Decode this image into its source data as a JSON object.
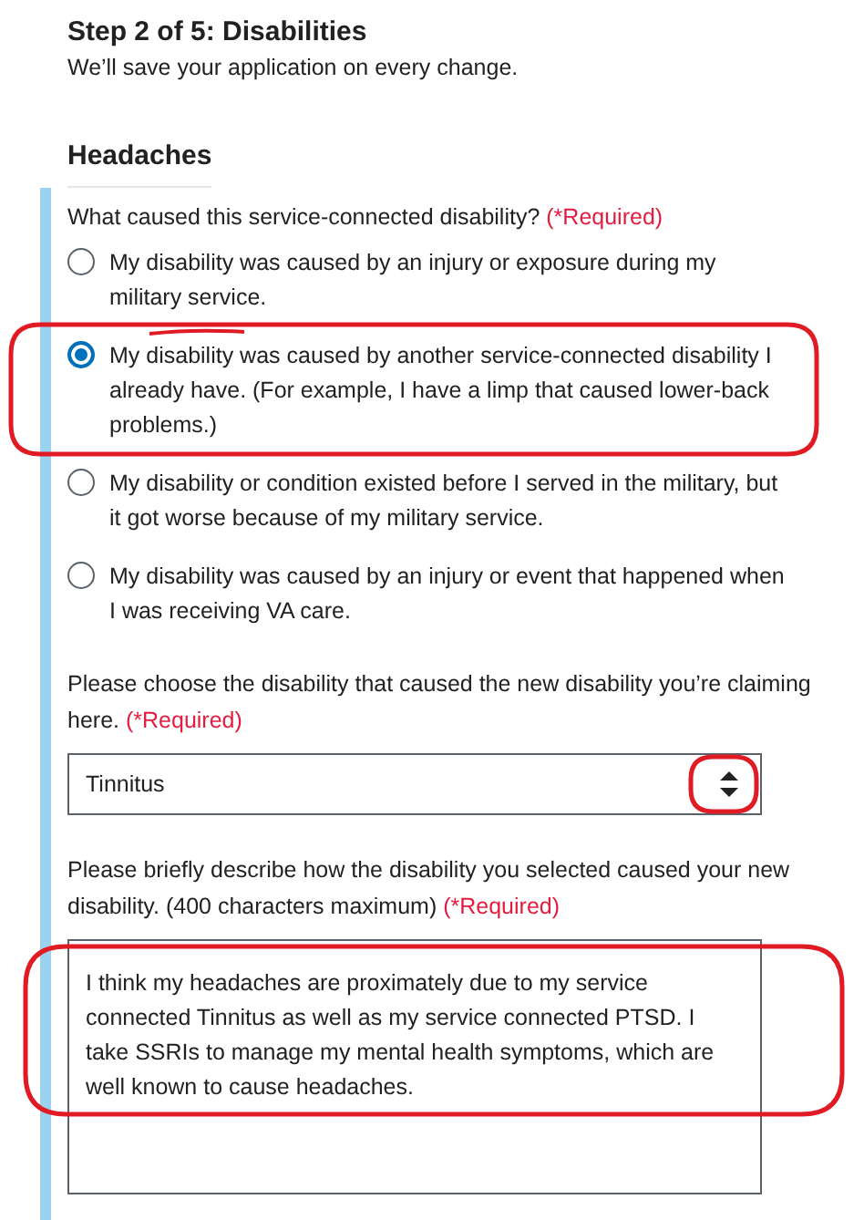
{
  "header": {
    "title": "Step 2 of 5: Disabilities",
    "subtitle": "We’ll save your application on every change."
  },
  "section": {
    "title": "Headaches",
    "question": {
      "label": "What caused this service-connected disability?",
      "required": "(*Required)",
      "options": [
        {
          "label": "My disability was caused by an injury or exposure during my military service.",
          "selected": false
        },
        {
          "label": "My disability was caused by another service-connected disability I already have. (For example, I have a limp that caused lower-back problems.)",
          "selected": true
        },
        {
          "label": "My disability or condition existed before I served in the military, but it got worse because of my military service.",
          "selected": false
        },
        {
          "label": "My disability was caused by an injury or event that happened when I was receiving VA care.",
          "selected": false
        }
      ]
    },
    "select": {
      "label": "Please choose the disability that caused the new disability you’re claiming here.",
      "required": "(*Required)",
      "value": "Tinnitus"
    },
    "description": {
      "label": "Please briefly describe how the disability you selected caused your new disability. (400 characters maximum)",
      "required": "(*Required)",
      "value": "I think my headaches are proximately due to my service connected Tinnitus as well as my service connected PTSD. I take SSRIs to manage my mental health symptoms, which are well known to cause headaches."
    }
  }
}
